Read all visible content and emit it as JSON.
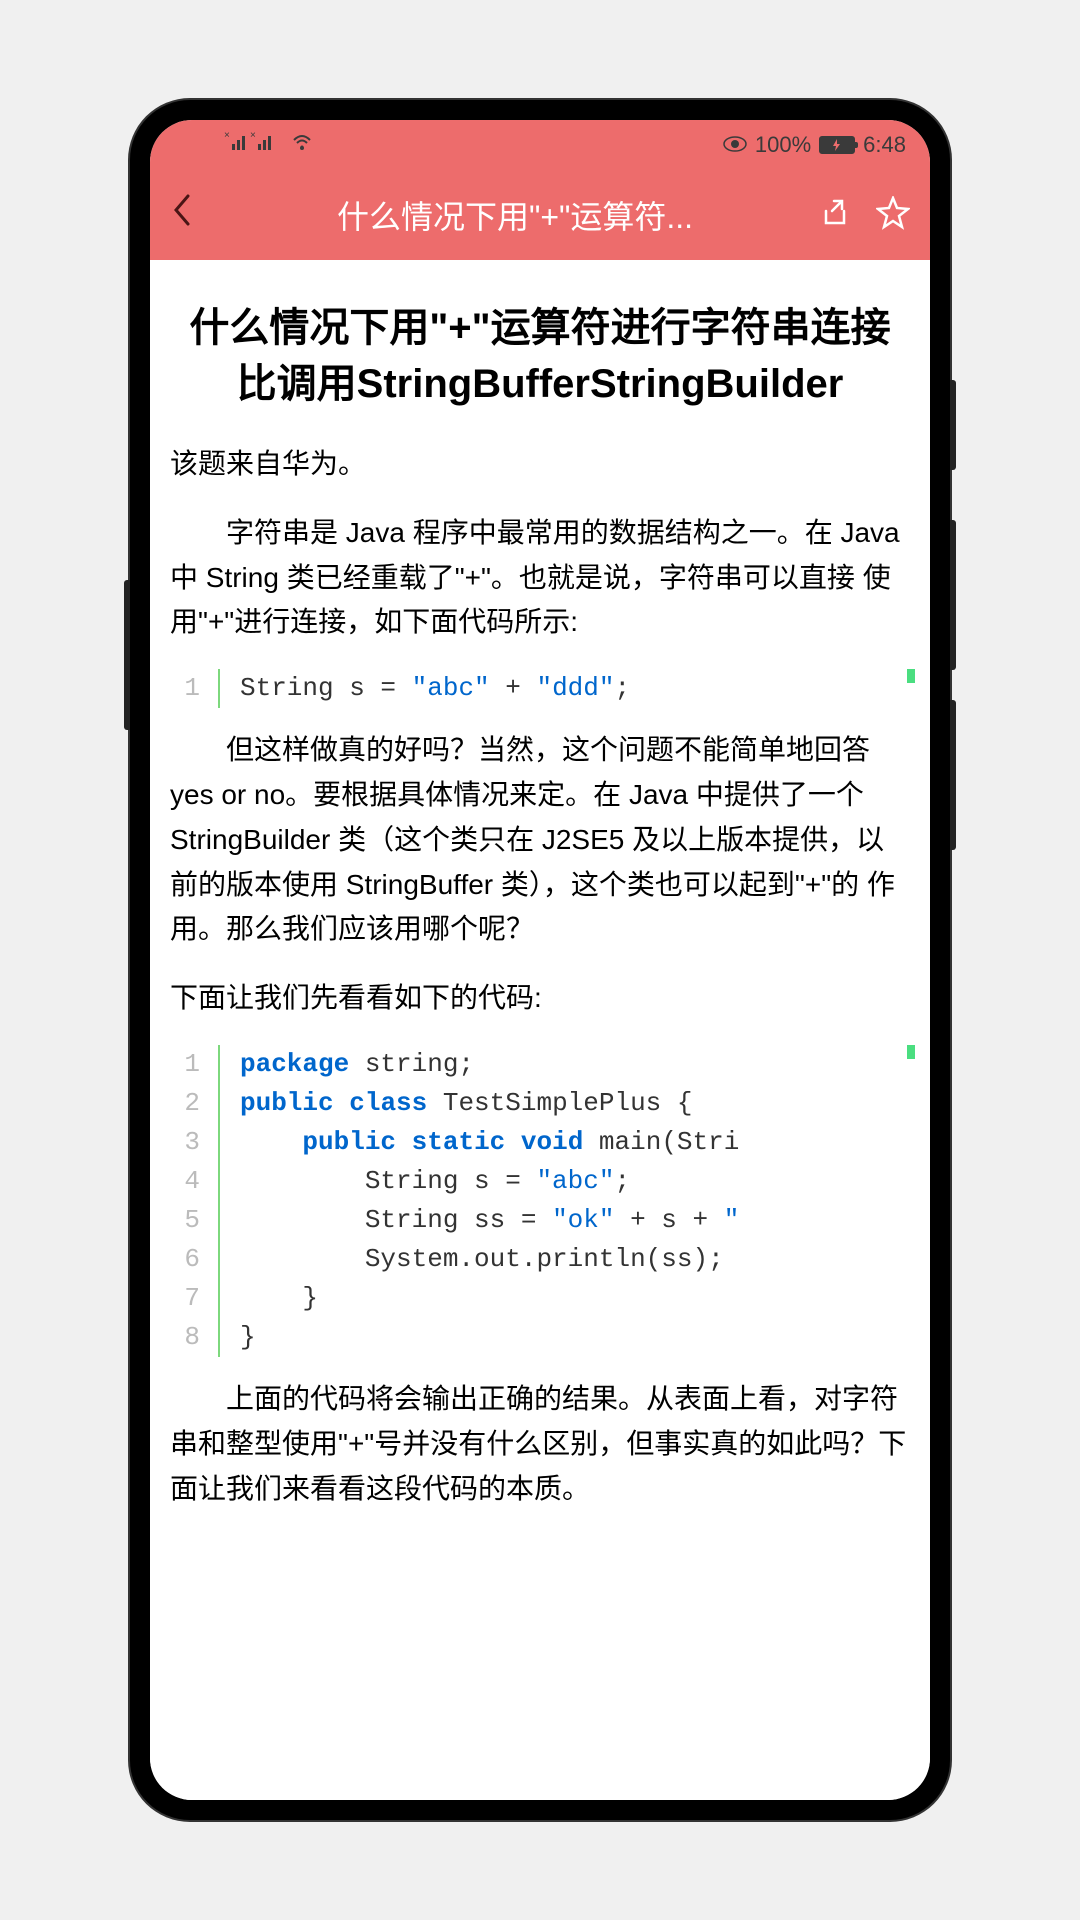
{
  "status_bar": {
    "signal_text": "×ᴵᴵᴵ ×ᴵᴵᴵ",
    "wifi": "≈",
    "battery_percent": "100%",
    "time": "6:48"
  },
  "header": {
    "title": "什么情况下用\"+\"运算符..."
  },
  "article": {
    "title": "什么情况下用\"+\"运算符进行字符串连接比调用StringBufferStringBuilder",
    "source": "该题来自华为。",
    "para1": "字符串是 Java 程序中最常用的数据结构之一。在 Java 中 String 类已经重载了\"+\"。也就是说，字符串可以直接 使用\"+\"进行连接，如下面代码所示:",
    "para2": "但这样做真的好吗？当然，这个问题不能简单地回答 yes or no。要根据具体情况来定。在 Java 中提供了一个 StringBuilder 类（这个类只在 J2SE5 及以上版本提供，以前的版本使用 StringBuffer 类），这个类也可以起到\"+\"的 作用。那么我们应该用哪个呢？",
    "para3": "下面让我们先看看如下的代码:",
    "para4": "上面的代码将会输出正确的结果。从表面上看，对字符串和整型使用\"+\"号并没有什么区别，但事实真的如此吗？下面让我们来看看这段代码的本质。"
  },
  "code1": {
    "line1_num": "1",
    "line1": "String s = ",
    "line1_str": "\"abc\"",
    "line1_mid": " + ",
    "line1_str2": "\"ddd\"",
    "line1_end": ";"
  },
  "code2": {
    "line_nums": [
      "1",
      "2",
      "3",
      "4",
      "5",
      "6",
      "7",
      "8"
    ],
    "l1_kw": "package",
    "l1_rest": " string;",
    "l2_kw1": "public",
    "l2_kw2": "class",
    "l2_rest": " TestSimplePlus {",
    "l3_kw1": "public",
    "l3_kw2": "static",
    "l3_kw3": "void",
    "l3_rest": " main(Stri",
    "l4_a": "        String s = ",
    "l4_str": "\"abc\"",
    "l4_end": ";",
    "l5_a": "        String ss = ",
    "l5_str": "\"ok\"",
    "l5_mid": " + s + ",
    "l5_str2": "\"",
    "l6": "        System.out.println(ss);",
    "l7": "    }",
    "l8": "}"
  }
}
